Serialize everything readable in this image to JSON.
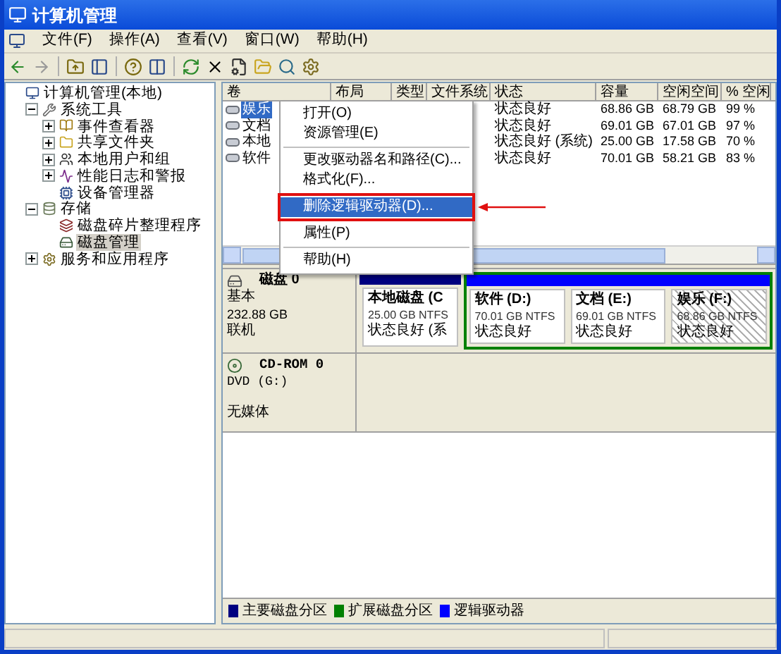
{
  "window": {
    "title": "计算机管理"
  },
  "menu_bar": [
    "文件(F)",
    "操作(A)",
    "查看(V)",
    "窗口(W)",
    "帮助(H)"
  ],
  "tree": [
    {
      "label": "计算机管理(本地)",
      "selected": false,
      "children": [
        {
          "label": "系统工具",
          "expanded": true,
          "selected": false,
          "children": [
            {
              "label": "事件查看器",
              "expanded": false,
              "selected": false
            },
            {
              "label": "共享文件夹",
              "expanded": false,
              "selected": false
            },
            {
              "label": "本地用户和组",
              "expanded": false,
              "selected": false
            },
            {
              "label": "性能日志和警报",
              "expanded": false,
              "selected": false
            },
            {
              "label": "设备管理器",
              "selected": false
            }
          ]
        },
        {
          "label": "存储",
          "expanded": true,
          "selected": false,
          "children": [
            {
              "label": "磁盘碎片整理程序",
              "selected": false
            },
            {
              "label": "磁盘管理",
              "selected": true
            }
          ]
        },
        {
          "label": "服务和应用程序",
          "expanded": false,
          "selected": false
        }
      ]
    }
  ],
  "volume_table": {
    "columns": [
      "卷",
      "布局",
      "类型",
      "文件系统",
      "状态",
      "容量",
      "空闲空间",
      "% 空闲"
    ],
    "rows": [
      {
        "volume": "娱乐",
        "status": "状态良好",
        "capacity": "68.86 GB",
        "free": "68.79 GB",
        "percent_free": "99 %",
        "selected": true
      },
      {
        "volume": "文档",
        "status": "状态良好",
        "capacity": "69.01 GB",
        "free": "67.01 GB",
        "percent_free": "97 %",
        "selected": false
      },
      {
        "volume": "本地",
        "status": "状态良好 (系统)",
        "capacity": "25.00 GB",
        "free": "17.58 GB",
        "percent_free": "70 %",
        "selected": false
      },
      {
        "volume": "软件",
        "status": "状态良好",
        "capacity": "70.01 GB",
        "free": "58.21 GB",
        "percent_free": "83 %",
        "selected": false
      }
    ]
  },
  "context_menu": [
    {
      "kind": "item",
      "label": "打开(O)",
      "selected": false
    },
    {
      "kind": "item",
      "label": "资源管理(E)",
      "selected": false
    },
    {
      "kind": "separator"
    },
    {
      "kind": "item",
      "label": "更改驱动器名和路径(C)...",
      "selected": false
    },
    {
      "kind": "item",
      "label": "格式化(F)...",
      "selected": false
    },
    {
      "kind": "separator"
    },
    {
      "kind": "item",
      "label": "删除逻辑驱动器(D)...",
      "selected": true,
      "annotated": true
    },
    {
      "kind": "separator"
    },
    {
      "kind": "item",
      "label": "属性(P)",
      "selected": false
    },
    {
      "kind": "separator"
    },
    {
      "kind": "item",
      "label": "帮助(H)",
      "selected": false
    }
  ],
  "disks": [
    {
      "kind": "disk",
      "name": "磁盘 0",
      "type": "基本",
      "size": "232.88 GB",
      "status": "联机",
      "partitions": [
        {
          "kind": "primary",
          "name": "本地磁盘 (C",
          "size": "25.00 GB NTFS",
          "status": "状态良好 (系",
          "selected": false
        },
        {
          "kind": "extended",
          "partitions": [
            {
              "kind": "logical",
              "name": "软件 (D:)",
              "size": "70.01 GB NTFS",
              "status": "状态良好",
              "selected": false
            },
            {
              "kind": "logical",
              "name": "文档 (E:)",
              "size": "69.01 GB NTFS",
              "status": "状态良好",
              "selected": false
            },
            {
              "kind": "logical",
              "name": "娱乐 (F:)",
              "size": "68.86 GB NTFS",
              "status": "状态良好",
              "selected": true
            }
          ]
        }
      ]
    },
    {
      "kind": "cdrom",
      "name": "CD-ROM 0",
      "type": "DVD (G:)",
      "status": "无媒体"
    }
  ],
  "legend": [
    {
      "label": "主要磁盘分区",
      "color": "#000080"
    },
    {
      "label": "扩展磁盘分区",
      "color": "#008000"
    },
    {
      "label": "逻辑驱动器",
      "color": "#0000ff"
    }
  ]
}
